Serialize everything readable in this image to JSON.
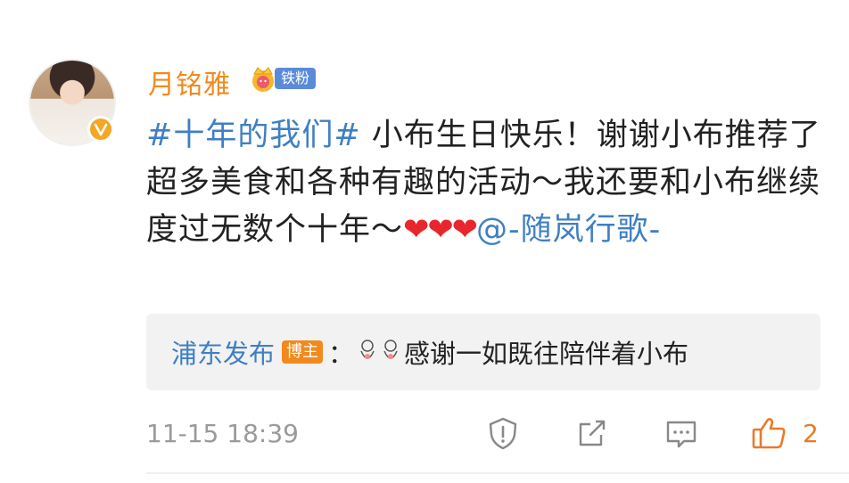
{
  "post": {
    "username": "月铭雅",
    "fan_badge": "铁粉",
    "hashtag": "#十年的我们#",
    "text_main": " 小布生日快乐！谢谢小布推荐了超多美食和各种有趣的活动～我还要和小布继续度过无数个十年～",
    "hearts": "❤❤❤",
    "mention": "@-随岚行歌-"
  },
  "reply": {
    "user": "浦东发布",
    "tag": "博主",
    "colon": "：",
    "text": "感谢一如既往陪伴着小布"
  },
  "footer": {
    "timestamp": "11-15 18:39",
    "like_count": "2"
  },
  "icons": {
    "report": "warning-shield-icon",
    "share": "share-icon",
    "comment": "comment-icon",
    "like": "thumbs-up-icon"
  },
  "colors": {
    "username": "#f08a1c",
    "link": "#3f7fc4",
    "like": "#e87a2a",
    "badge": "#5b8bd8"
  }
}
